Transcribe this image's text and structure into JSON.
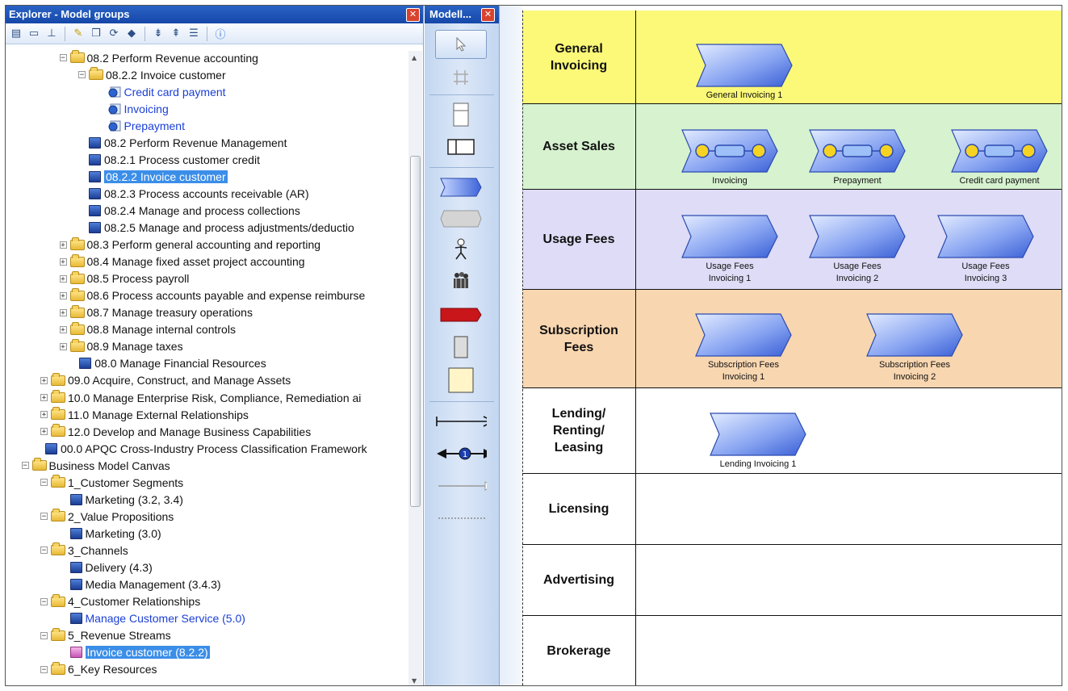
{
  "explorer": {
    "title": "Explorer - Model groups",
    "tree": [
      {
        "label": "08.2 Perform Revenue accounting",
        "icon": "folder",
        "pm": "−",
        "indent": 1
      },
      {
        "label": "08.2.2 Invoice customer",
        "icon": "folder",
        "pm": "−",
        "indent": 2
      },
      {
        "label": "Credit card payment",
        "icon": "process",
        "link": true,
        "indent": 3
      },
      {
        "label": "Invoicing",
        "icon": "process",
        "link": true,
        "indent": 3
      },
      {
        "label": "Prepayment",
        "icon": "process",
        "link": true,
        "indent": 3
      },
      {
        "label": "08.2 Perform Revenue Management",
        "icon": "doc",
        "indent": 2
      },
      {
        "label": "08.2.1 Process customer credit",
        "icon": "doc",
        "indent": 2
      },
      {
        "label": "08.2.2 Invoice customer",
        "icon": "doc",
        "indent": 2,
        "selected": true
      },
      {
        "label": "08.2.3 Process accounts receivable (AR)",
        "icon": "doc",
        "indent": 2
      },
      {
        "label": "08.2.4 Manage and process collections",
        "icon": "doc",
        "indent": 2
      },
      {
        "label": "08.2.5 Manage and process adjustments/deductio",
        "icon": "doc",
        "indent": 2
      },
      {
        "label": "08.3 Perform general accounting and reporting",
        "icon": "folder",
        "pm": "+",
        "indent": 1
      },
      {
        "label": "08.4 Manage fixed asset project accounting",
        "icon": "folder",
        "pm": "+",
        "indent": 1
      },
      {
        "label": "08.5 Process payroll",
        "icon": "folder",
        "pm": "+",
        "indent": 1
      },
      {
        "label": "08.6 Process accounts payable and expense reimburse",
        "icon": "folder",
        "pm": "+",
        "indent": 1
      },
      {
        "label": "08.7 Manage treasury operations",
        "icon": "folder",
        "pm": "+",
        "indent": 1
      },
      {
        "label": "08.8 Manage internal controls",
        "icon": "folder",
        "pm": "+",
        "indent": 1
      },
      {
        "label": "08.9 Manage taxes",
        "icon": "folder",
        "pm": "+",
        "indent": 1
      },
      {
        "label": "08.0 Manage Financial Resources",
        "icon": "doc",
        "indent": 1.5
      },
      {
        "label": "09.0 Acquire, Construct, and Manage Assets",
        "icon": "folder",
        "pm": "+",
        "indent": 0
      },
      {
        "label": "10.0 Manage Enterprise Risk, Compliance, Remediation ai",
        "icon": "folder",
        "pm": "+",
        "indent": 0
      },
      {
        "label": "11.0 Manage External Relationships",
        "icon": "folder",
        "pm": "+",
        "indent": 0
      },
      {
        "label": "12.0 Develop and Manage Business Capabilities",
        "icon": "folder",
        "pm": "+",
        "indent": 0
      },
      {
        "label": "00.0 APQC Cross-Industry Process Classification Framework",
        "icon": "doc",
        "indent": -0.3
      },
      {
        "label": "Business Model Canvas",
        "icon": "folder",
        "pm": "−",
        "indent": -1
      },
      {
        "label": "1_Customer Segments",
        "icon": "folder",
        "pm": "−",
        "indent": 0
      },
      {
        "label": "Marketing (3.2, 3.4)",
        "icon": "doc",
        "indent": 1
      },
      {
        "label": "2_Value Propositions",
        "icon": "folder",
        "pm": "−",
        "indent": 0
      },
      {
        "label": "Marketing (3.0)",
        "icon": "doc",
        "indent": 1
      },
      {
        "label": "3_Channels",
        "icon": "folder",
        "pm": "−",
        "indent": 0
      },
      {
        "label": "Delivery (4.3)",
        "icon": "doc",
        "indent": 1
      },
      {
        "label": "Media Management (3.4.3)",
        "icon": "doc",
        "indent": 1
      },
      {
        "label": "4_Customer Relationships",
        "icon": "folder",
        "pm": "−",
        "indent": 0
      },
      {
        "label": "Manage Customer Service (5.0)",
        "icon": "doc",
        "link": true,
        "indent": 1
      },
      {
        "label": "5_Revenue Streams",
        "icon": "folder",
        "pm": "−",
        "indent": 0
      },
      {
        "label": "Invoice customer (8.2.2)",
        "icon": "doc-pink",
        "indent": 1,
        "selected": true
      },
      {
        "label": "6_Key Resources",
        "icon": "folder",
        "pm": "−",
        "indent": 0
      }
    ]
  },
  "toolbox": {
    "title": "Modell..."
  },
  "diagram": {
    "lanes": [
      {
        "label": "General\nInvoicing",
        "color": "#fbf977"
      },
      {
        "label": "Asset Sales",
        "color": "#d6f2cf"
      },
      {
        "label": "Usage Fees",
        "color": "#dedcf6"
      },
      {
        "label": "Subscription\nFees",
        "color": "#f8d6b0"
      },
      {
        "label": "Lending/\nRenting/\nLeasing",
        "color": "#ffffff"
      },
      {
        "label": "Licensing",
        "color": "#ffffff"
      },
      {
        "label": "Advertising",
        "color": "#ffffff"
      },
      {
        "label": "Brokerage",
        "color": "#ffffff"
      }
    ],
    "shapes": [
      {
        "label": "General Invoicing 1"
      },
      {
        "label": "Invoicing"
      },
      {
        "label": "Prepayment"
      },
      {
        "label": "Credit card payment"
      },
      {
        "label": "Usage Fees\nInvoicing 1"
      },
      {
        "label": "Usage Fees\nInvoicing 2"
      },
      {
        "label": "Usage Fees\nInvoicing 3"
      },
      {
        "label": "Subscription Fees\nInvoicing 1"
      },
      {
        "label": "Subscription Fees\nInvoicing 2"
      },
      {
        "label": "Lending Invoicing 1"
      }
    ]
  },
  "colors": {
    "title_bar": "#1b4fb0",
    "selection": "#3b8ee8",
    "shape_fill": "#7f9ff0",
    "link_text": "#1a3fd6"
  }
}
